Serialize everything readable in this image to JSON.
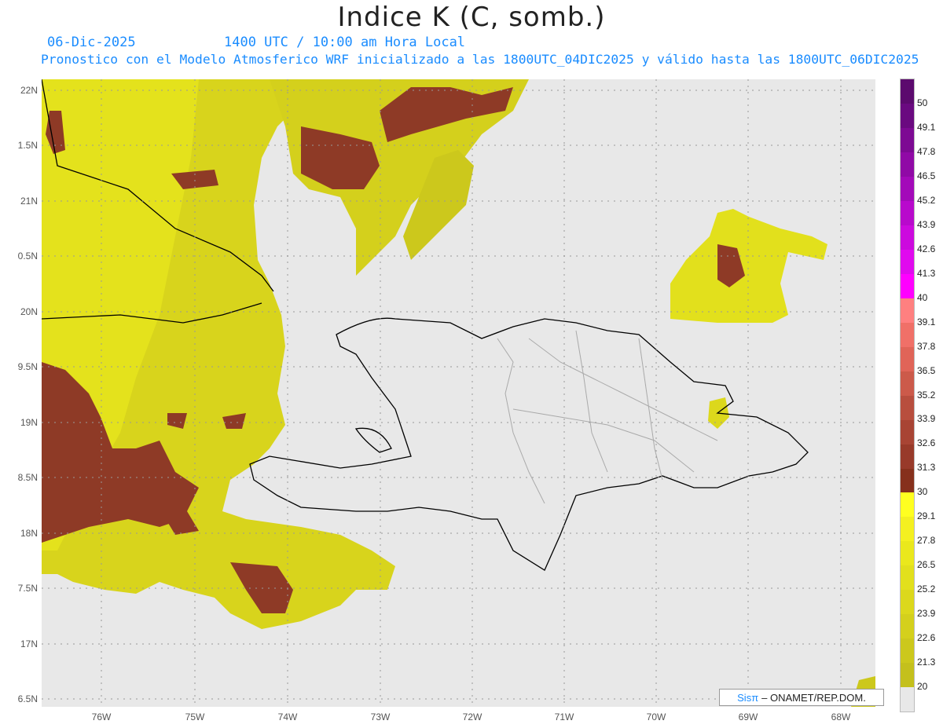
{
  "title": "Indice K (C, somb.)",
  "date": "06-Dic-2025",
  "time": "1400 UTC / 10:00 am Hora Local",
  "description": "Pronostico con el Modelo Atmosferico WRF inicializado a las 1800UTC_04DIC2025 y válido hasta las  1800UTC_06DIC2025",
  "lat_labels": [
    "22N",
    "1.5N",
    "21N",
    "0.5N",
    "20N",
    "9.5N",
    "19N",
    "8.5N",
    "18N",
    "7.5N",
    "17N",
    "6.5N"
  ],
  "lon_labels": [
    "76W",
    "75W",
    "74W",
    "73W",
    "72W",
    "71W",
    "70W",
    "69W",
    "68W"
  ],
  "colorbar": {
    "labels": [
      "50",
      "49.1",
      "47.8",
      "46.5",
      "45.2",
      "43.9",
      "42.6",
      "41.3",
      "40",
      "39.1",
      "37.8",
      "36.5",
      "35.2",
      "33.9",
      "32.6",
      "31.3",
      "30",
      "29.1",
      "27.8",
      "26.5",
      "25.2",
      "23.9",
      "22.6",
      "21.3",
      "20"
    ],
    "colors": [
      "#5c0a6e",
      "#6a0a80",
      "#7d0a93",
      "#900aa6",
      "#a30ab9",
      "#b80acc",
      "#cc0ade",
      "#e00aee",
      "#ff00ff",
      "#ff8080",
      "#f07068",
      "#e06458",
      "#cc5a4a",
      "#b84e3e",
      "#a84434",
      "#983a2a",
      "#86301c",
      "#ffff20",
      "#f4f020",
      "#eae81c",
      "#e2e01c",
      "#dcd81c",
      "#d4d01c",
      "#ccc81c",
      "#c4c01c",
      "#e8e8e8"
    ]
  },
  "watermark": {
    "brand": "Sisπ",
    "text": "– ONAMET/REP.DOM."
  }
}
